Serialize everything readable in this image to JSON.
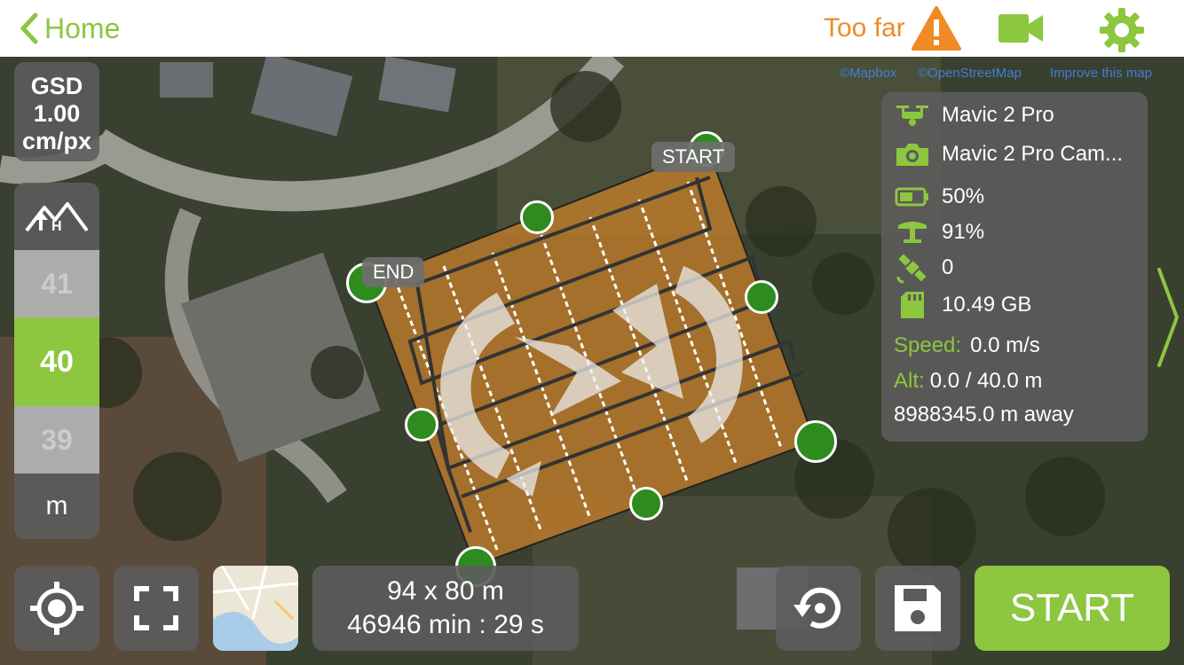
{
  "header": {
    "back_label": "Home",
    "warning_text": "Too far"
  },
  "map": {
    "attribution": [
      "©Mapbox",
      "©OpenStreetMap",
      "Improve this map"
    ],
    "start_label": "START",
    "end_label": "END"
  },
  "gsd": {
    "label": "GSD",
    "value": "1.00",
    "unit": "cm/px"
  },
  "altitude_selector": {
    "above": "41",
    "selected": "40",
    "below": "39",
    "unit": "m"
  },
  "info": {
    "drone": "Mavic 2 Pro",
    "camera": "Mavic 2 Pro Cam...",
    "battery": "50%",
    "controller_signal": "91%",
    "satellites": "0",
    "storage": "10.49 GB",
    "speed_label": "Speed:",
    "speed_value": "0.0 m/s",
    "alt_label": "Alt:",
    "alt_value": "0.0 / 40.0 m",
    "distance": "8988345.0 m away"
  },
  "footer": {
    "dimensions": "94 x 80 m",
    "duration": "46946 min : 29 s",
    "start_label": "START"
  },
  "colors": {
    "accent": "#8dc63f",
    "warning": "#f08a24",
    "panel": "#5c5c5c",
    "grid_fill": "#c8802a",
    "handle": "#2e8b1e"
  },
  "icons": [
    "chevron-left-icon",
    "warning-icon",
    "video-camera-icon",
    "gear-icon",
    "terrain-icon",
    "drone-icon",
    "camera-icon",
    "battery-icon",
    "controller-icon",
    "satellite-icon",
    "sd-card-icon",
    "crosshair-icon",
    "fullscreen-icon",
    "map-thumbnail",
    "reset-icon",
    "save-icon",
    "chevron-right-icon"
  ]
}
